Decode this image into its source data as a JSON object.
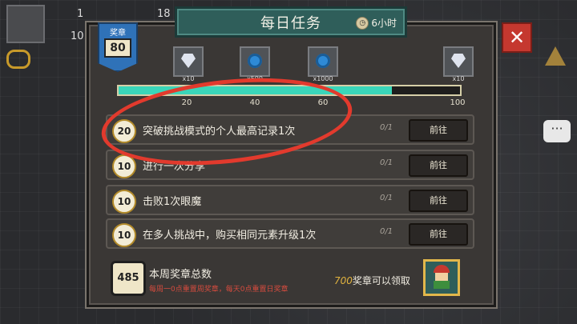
{
  "hud": {
    "stat1": "1",
    "stat2": "18",
    "stat3": "10"
  },
  "panel": {
    "title": "每日任务",
    "timer": "6小时",
    "badge_label": "奖章",
    "badge_value": "80"
  },
  "rewards": [
    {
      "icon": "diamond-icon",
      "qty": "x10"
    },
    {
      "icon": "blue-gem-icon",
      "qty": "x500"
    },
    {
      "icon": "blue-gem-icon",
      "qty": "x1000"
    },
    {
      "icon": "diamond-icon",
      "qty": "x10"
    }
  ],
  "progress": {
    "value": 80,
    "max": 100,
    "milestones": [
      "20",
      "40",
      "60",
      "100"
    ]
  },
  "tasks": [
    {
      "points": "20",
      "text": "突破挑战模式的个人最高记录1次",
      "progress": "0/1",
      "button": "前往"
    },
    {
      "points": "10",
      "text": "进行一次分享",
      "progress": "0/1",
      "button": "前往"
    },
    {
      "points": "10",
      "text": "击败1次眼魔",
      "progress": "0/1",
      "button": "前往"
    },
    {
      "points": "10",
      "text": "在多人挑战中，购买相同元素升级1次",
      "progress": "0/1",
      "button": "前往"
    }
  ],
  "weekly": {
    "total": "485",
    "title": "本周奖章总数",
    "note": "每周一0点重置周奖章，每天0点重置日奖章",
    "claim_amount": "700",
    "claim_text": "奖章可以领取"
  },
  "colors": {
    "accent_teal": "#3ad6b9",
    "annotation_red": "#e23a2d",
    "badge_blue": "#2f72b8"
  }
}
